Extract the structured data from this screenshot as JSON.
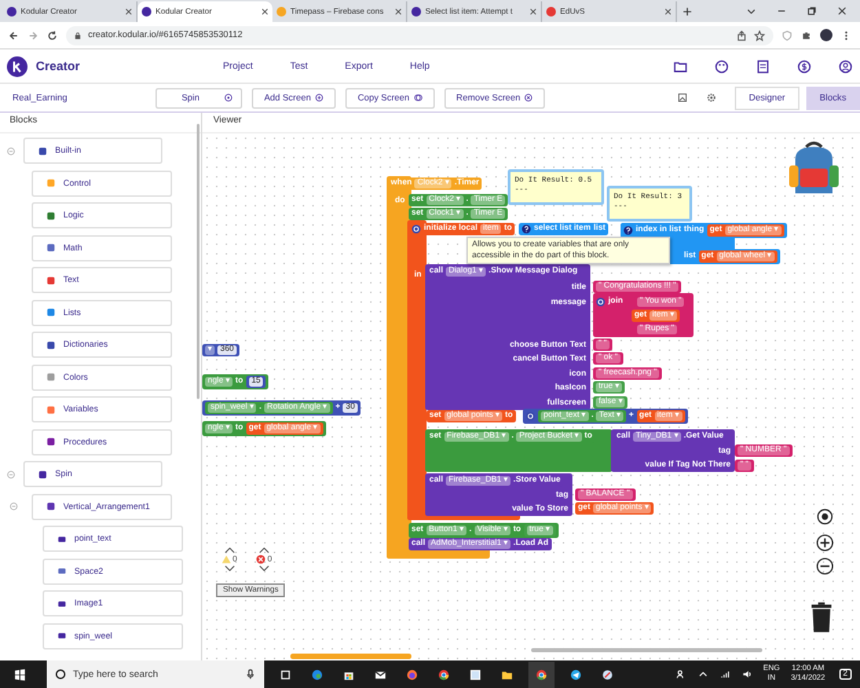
{
  "browser": {
    "tabs": [
      {
        "title": "Kodular Creator",
        "selected": false
      },
      {
        "title": "Kodular Creator",
        "selected": true
      },
      {
        "title": "Timepass – Firebase cons",
        "selected": false
      },
      {
        "title": "Select list item: Attempt t",
        "selected": false
      },
      {
        "title": "EdUvS",
        "selected": false
      }
    ],
    "address": "creator.kodular.io/#6165745853530112"
  },
  "app": {
    "brand": "Creator",
    "menu": [
      "Project",
      "Test",
      "Export",
      "Help"
    ]
  },
  "toolbar": {
    "project": "Real_Earning",
    "screen": "Spin",
    "actions": [
      "Add Screen",
      "Copy Screen",
      "Remove Screen"
    ],
    "views": [
      {
        "label": "Designer",
        "selected": false
      },
      {
        "label": "Blocks",
        "selected": true
      }
    ]
  },
  "sidebar": {
    "title": "Blocks",
    "tree": [
      {
        "label": "Built-in",
        "expanded": true,
        "children": [
          {
            "label": "Control"
          },
          {
            "label": "Logic"
          },
          {
            "label": "Math"
          },
          {
            "label": "Text"
          },
          {
            "label": "Lists"
          },
          {
            "label": "Dictionaries"
          },
          {
            "label": "Colors"
          },
          {
            "label": "Variables"
          },
          {
            "label": "Procedures"
          }
        ]
      },
      {
        "label": "Spin",
        "expanded": true,
        "children": [
          {
            "label": "Vertical_Arrangement1",
            "expanded": true,
            "children": [
              {
                "label": "point_text"
              },
              {
                "label": "Space2"
              },
              {
                "label": "Image1"
              },
              {
                "label": "spin_weel"
              }
            ]
          }
        ]
      }
    ]
  },
  "viewer": {
    "title": "Viewer",
    "blocks": [
      {
        "kind": "math",
        "parts": [
          {
            "kind": "dd",
            "text": "▾"
          },
          {
            "kind": "num",
            "text": "360"
          }
        ]
      },
      {
        "kind": "set",
        "parts": [
          {
            "kind": "dd",
            "text": "ngle ▾"
          },
          {
            "kind": "kw",
            "text": "to"
          },
          {
            "kind": "math",
            "parts": [
              {
                "kind": "num",
                "text": "15"
              }
            ]
          }
        ]
      },
      {
        "kind": "math",
        "parts": [
          {
            "kind": "set",
            "parts": [
              {
                "kind": "dd",
                "text": "spin_weel ▾"
              },
              {
                "kind": "kw",
                "text": "."
              },
              {
                "kind": "dd",
                "text": "Rotation Angle ▾"
              }
            ]
          },
          {
            "kind": "kw",
            "text": "+"
          },
          {
            "kind": "num",
            "text": "30"
          }
        ]
      },
      {
        "kind": "set",
        "parts": [
          {
            "kind": "dd",
            "text": "ngle ▾"
          },
          {
            "kind": "kw",
            "text": "to"
          },
          {
            "kind": "variable",
            "parts": [
              {
                "kind": "kw",
                "text": "get"
              },
              {
                "kind": "dd",
                "text": "global angle ▾"
              }
            ]
          }
        ]
      },
      {
        "kind": "event",
        "parts": [
          {
            "kind": "kw",
            "text": "when"
          },
          {
            "kind": "dd",
            "text": "Clock2 ▾"
          },
          {
            "kind": "kw",
            "text": ".Timer"
          }
        ]
      },
      {
        "kind": "label",
        "parts": [
          {
            "kind": "kw",
            "text": "do"
          }
        ]
      },
      {
        "kind": "set",
        "parts": [
          {
            "kind": "kw",
            "text": "set"
          },
          {
            "kind": "dd",
            "text": "Clock2 ▾"
          },
          {
            "kind": "kw",
            "text": "."
          },
          {
            "kind": "dd",
            "text": "Timer E"
          }
        ]
      },
      {
        "kind": "set",
        "parts": [
          {
            "kind": "kw",
            "text": "set"
          },
          {
            "kind": "dd",
            "text": "Clock1 ▾"
          },
          {
            "kind": "kw",
            "text": "."
          },
          {
            "kind": "dd",
            "text": "Timer E"
          }
        ]
      },
      {
        "kind": "variable",
        "parts": [
          {
            "kind": "mutator"
          },
          {
            "kind": "kw",
            "text": "initialize local"
          },
          {
            "kind": "dd",
            "text": "item"
          },
          {
            "kind": "kw",
            "text": "to"
          }
        ]
      },
      {
        "kind": "list",
        "parts": [
          {
            "kind": "help"
          },
          {
            "kind": "kw",
            "text": "select list item"
          },
          {
            "kind": "kw",
            "text": "list"
          }
        ]
      },
      {
        "kind": "list",
        "parts": [
          {
            "kind": "help"
          },
          {
            "kind": "kw",
            "text": "index in list"
          },
          {
            "kind": "kw",
            "text": "thing"
          },
          {
            "kind": "variable",
            "parts": [
              {
                "kind": "kw",
                "text": "get"
              },
              {
                "kind": "dd",
                "text": "global angle ▾"
              }
            ]
          }
        ]
      },
      {
        "kind": "list",
        "parts": [
          {
            "kind": "kw",
            "text": "list"
          },
          {
            "kind": "variable",
            "parts": [
              {
                "kind": "kw",
                "text": "get"
              },
              {
                "kind": "dd",
                "text": "global wheel ▾"
              }
            ]
          }
        ]
      },
      {
        "kind": "label",
        "parts": [
          {
            "kind": "kw",
            "text": "in"
          }
        ]
      },
      {
        "kind": "call",
        "parts": [
          {
            "kind": "kw",
            "text": "call"
          },
          {
            "kind": "dd",
            "text": "Dialog1 ▾"
          },
          {
            "kind": "kw",
            "text": ".Show Message Dialog"
          }
        ]
      },
      {
        "kind": "label",
        "parts": [
          {
            "kind": "kw",
            "text": "title"
          }
        ]
      },
      {
        "kind": "label",
        "parts": [
          {
            "kind": "kw",
            "text": "message"
          }
        ]
      },
      {
        "kind": "label",
        "parts": [
          {
            "kind": "kw",
            "text": "choose Button Text"
          }
        ]
      },
      {
        "kind": "label",
        "parts": [
          {
            "kind": "kw",
            "text": "cancel Button Text"
          }
        ]
      },
      {
        "kind": "label",
        "parts": [
          {
            "kind": "kw",
            "text": "icon"
          }
        ]
      },
      {
        "kind": "label",
        "parts": [
          {
            "kind": "kw",
            "text": "hasIcon"
          }
        ]
      },
      {
        "kind": "label",
        "parts": [
          {
            "kind": "kw",
            "text": "fullscreen"
          }
        ]
      },
      {
        "kind": "text",
        "parts": [
          {
            "kind": "str",
            "text": "\" Congratulations !!! \""
          }
        ]
      },
      {
        "kind": "text",
        "parts": [
          {
            "kind": "mutator"
          },
          {
            "kind": "kw",
            "text": "join"
          }
        ]
      },
      {
        "kind": "text",
        "parts": [
          {
            "kind": "str",
            "text": "\" You won \""
          }
        ]
      },
      {
        "kind": "variable",
        "parts": [
          {
            "kind": "kw",
            "text": "get"
          },
          {
            "kind": "dd",
            "text": "item ▾"
          }
        ]
      },
      {
        "kind": "text",
        "parts": [
          {
            "kind": "str",
            "text": "\" Rupes \""
          }
        ]
      },
      {
        "kind": "text",
        "parts": [
          {
            "kind": "str",
            "text": "\"   \""
          }
        ]
      },
      {
        "kind": "text",
        "parts": [
          {
            "kind": "str",
            "text": "\" ok \""
          }
        ]
      },
      {
        "kind": "text",
        "parts": [
          {
            "kind": "str",
            "text": "\" freecash.png \""
          }
        ]
      },
      {
        "kind": "logic",
        "parts": [
          {
            "kind": "dd",
            "text": "true ▾"
          }
        ]
      },
      {
        "kind": "logic",
        "parts": [
          {
            "kind": "dd",
            "text": "false ▾"
          }
        ]
      },
      {
        "kind": "variable",
        "parts": [
          {
            "kind": "kw",
            "text": "set"
          },
          {
            "kind": "dd",
            "text": "global points ▾"
          },
          {
            "kind": "kw",
            "text": "to"
          }
        ]
      },
      {
        "kind": "math",
        "parts": [
          {
            "kind": "mutator"
          },
          {
            "kind": "set",
            "parts": [
              {
                "kind": "dd",
                "text": "point_text ▾"
              },
              {
                "kind": "kw",
                "text": "."
              },
              {
                "kind": "dd",
                "text": "Text ▾"
              }
            ]
          },
          {
            "kind": "kw",
            "text": "+"
          },
          {
            "kind": "variable",
            "parts": [
              {
                "kind": "kw",
                "text": "get"
              },
              {
                "kind": "dd",
                "text": "item ▾"
              }
            ]
          }
        ]
      },
      {
        "kind": "set",
        "parts": [
          {
            "kind": "kw",
            "text": "set"
          },
          {
            "kind": "dd",
            "text": "Firebase_DB1 ▾"
          },
          {
            "kind": "kw",
            "text": "."
          },
          {
            "kind": "dd",
            "text": "Project Bucket ▾"
          },
          {
            "kind": "kw",
            "text": "to"
          }
        ]
      },
      {
        "kind": "call",
        "parts": [
          {
            "kind": "kw",
            "text": "call"
          },
          {
            "kind": "dd",
            "text": "Tiny_DB1 ▾"
          },
          {
            "kind": "kw",
            "text": ".Get Value"
          }
        ]
      },
      {
        "kind": "label",
        "parts": [
          {
            "kind": "kw",
            "text": "tag"
          }
        ]
      },
      {
        "kind": "label",
        "parts": [
          {
            "kind": "kw",
            "text": "value If Tag Not There"
          }
        ]
      },
      {
        "kind": "text",
        "parts": [
          {
            "kind": "str",
            "text": "\" NUMBER \""
          }
        ]
      },
      {
        "kind": "text",
        "parts": [
          {
            "kind": "str",
            "text": "\"   \""
          }
        ]
      },
      {
        "kind": "call",
        "parts": [
          {
            "kind": "kw",
            "text": "call"
          },
          {
            "kind": "dd",
            "text": "Firebase_DB1 ▾"
          },
          {
            "kind": "kw",
            "text": ".Store Value"
          }
        ]
      },
      {
        "kind": "label",
        "parts": [
          {
            "kind": "kw",
            "text": "tag"
          }
        ]
      },
      {
        "kind": "label",
        "parts": [
          {
            "kind": "kw",
            "text": "value To Store"
          }
        ]
      },
      {
        "kind": "text",
        "parts": [
          {
            "kind": "str",
            "text": "\" BALANCE \""
          }
        ]
      },
      {
        "kind": "variable",
        "parts": [
          {
            "kind": "kw",
            "text": "get"
          },
          {
            "kind": "dd",
            "text": "global points ▾"
          }
        ]
      },
      {
        "kind": "set",
        "parts": [
          {
            "kind": "kw",
            "text": "set"
          },
          {
            "kind": "dd",
            "text": "Button1 ▾"
          },
          {
            "kind": "kw",
            "text": "."
          },
          {
            "kind": "dd",
            "text": "Visible ▾"
          },
          {
            "kind": "kw",
            "text": "to"
          },
          {
            "kind": "logic",
            "parts": [
              {
                "kind": "dd",
                "text": "true ▾"
              }
            ]
          }
        ]
      },
      {
        "kind": "call",
        "parts": [
          {
            "kind": "kw",
            "text": "call"
          },
          {
            "kind": "dd",
            "text": "AdMob_Interstitial1 ▾"
          },
          {
            "kind": "kw",
            "text": ".Load Ad"
          }
        ]
      }
    ],
    "tooltip": "Allows you to create variables that are only accessible in the do part of this block.",
    "bubbles": [
      {
        "lines": [
          "Do It Result: 0.5",
          "---"
        ]
      },
      {
        "lines": [
          "Do It Result: 3",
          "---"
        ]
      }
    ],
    "warnings": {
      "warning_count": "0",
      "error_count": "0",
      "button": "Show Warnings"
    }
  },
  "taskbar": {
    "search_placeholder": "Type here to search",
    "language": "ENG",
    "region": "IN",
    "time": "12:00 AM",
    "date": "3/14/2022",
    "notifications": "2"
  }
}
